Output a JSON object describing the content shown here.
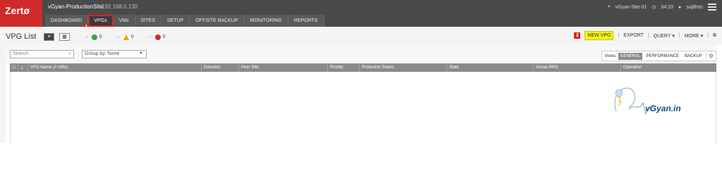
{
  "header": {
    "logo": "Zertø",
    "site_name": "vGyan-ProductionSite",
    "site_ip": "192.168.0.130",
    "location": "vGyan-Site-01",
    "time": "04:20",
    "user": "sujithsn"
  },
  "nav": {
    "tabs": [
      {
        "label": "DASHBOARD"
      },
      {
        "label": "VPGs"
      },
      {
        "label": "VMs"
      },
      {
        "label": "SITES"
      },
      {
        "label": "SETUP"
      },
      {
        "label": "OFFSITE BACKUP"
      },
      {
        "label": "MONITORING"
      },
      {
        "label": "REPORTS"
      }
    ],
    "marker1": "1"
  },
  "page": {
    "title": "VPG List",
    "status_ok": "0",
    "status_warn": "0",
    "status_err": "0"
  },
  "actions": {
    "marker2": "2",
    "new_vpg": "NEW VPG",
    "export": "EXPORT",
    "query": "QUERY ▾",
    "more": "MORE ▾"
  },
  "filters": {
    "search_placeholder": "Search",
    "group_by": "Group by: None"
  },
  "views": {
    "label": "Views:",
    "items": [
      "GENERAL",
      "PERFORMANCE",
      "BACKUP"
    ]
  },
  "grid": {
    "columns": [
      "VPG Name (# VMs)",
      "Direction",
      "Peer Site",
      "Priority",
      "Protection Status",
      "State",
      "Actual RPO",
      "Operation"
    ]
  },
  "watermark": "vGyan.in",
  "colors": {
    "header_bg": "#4a4a4a",
    "brand_red": "#d02a2a",
    "highlight_yellow": "#f2f215",
    "grid_header": "#8a8a8a"
  }
}
